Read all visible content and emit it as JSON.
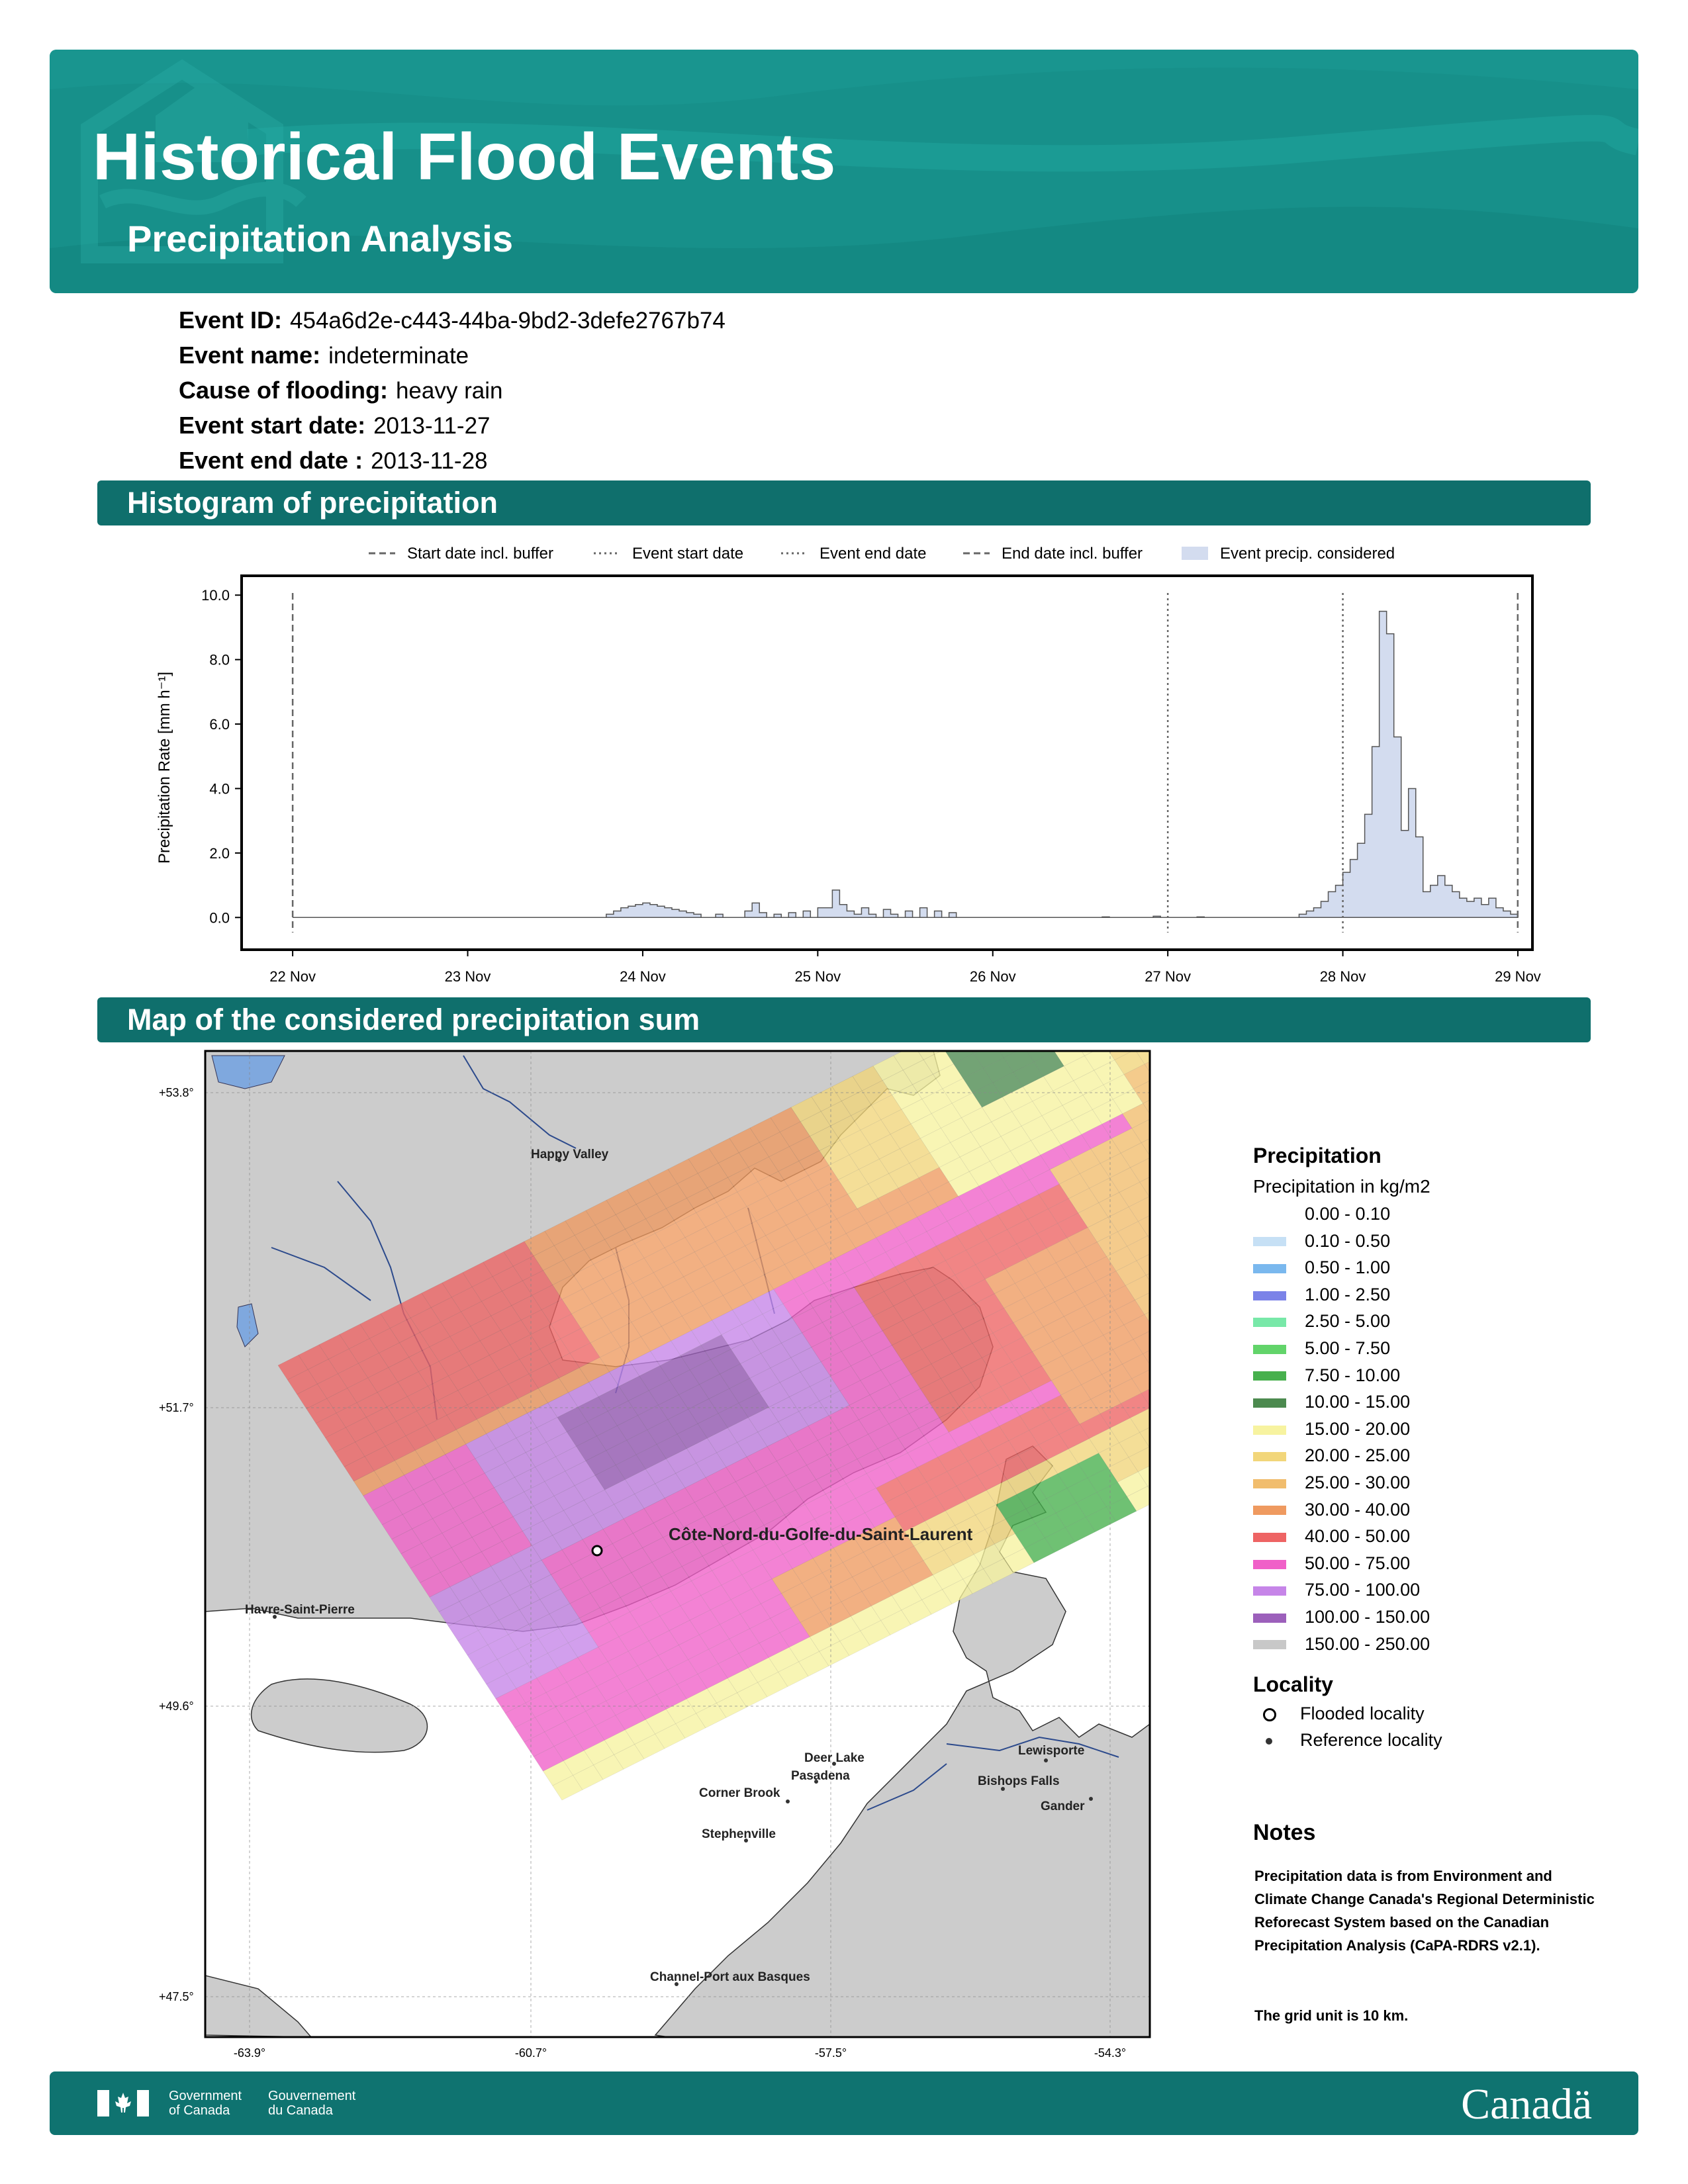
{
  "header": {
    "title": "Historical Flood Events",
    "subtitle": "Precipitation Analysis"
  },
  "event": {
    "id_label": "Event ID:",
    "id": "454a6d2e-c443-44ba-9bd2-3defe2767b74",
    "name_label": "Event name:",
    "name": "indeterminate",
    "cause_label": "Cause of flooding:",
    "cause": "heavy rain",
    "start_label": "Event start date:",
    "start": "2013-11-27",
    "end_label": "Event end date :",
    "end": "2013-11-28"
  },
  "histogram": {
    "section_title": "Histogram of precipitation",
    "legend": {
      "start_buffer": "Start date incl. buffer",
      "event_start": "Event start date",
      "event_end": "Event end date",
      "end_buffer": "End date incl. buffer",
      "considered": "Event precip. considered"
    },
    "colors": {
      "fill": "#d3dcef",
      "line": "#555555"
    }
  },
  "chart_data": {
    "type": "area",
    "title": "",
    "xlabel": "",
    "ylabel": "Precipitation Rate [mm h⁻¹]",
    "ylim": [
      -1.0,
      10.6
    ],
    "xlim": [
      "2013-11-21 17:00",
      "2013-11-29 02:00"
    ],
    "x_ticks": [
      "22 Nov",
      "23 Nov",
      "24 Nov",
      "25 Nov",
      "26 Nov",
      "27 Nov",
      "28 Nov",
      "29 Nov"
    ],
    "y_ticks": [
      "0.0",
      "2.0",
      "4.0",
      "6.0",
      "8.0",
      "10.0"
    ],
    "step_hours": 3,
    "start_time": "2013-11-22 00:00",
    "values": [
      0.0,
      0.0,
      0.0,
      0.0,
      0.0,
      0.0,
      0.0,
      0.0,
      0.0,
      0.0,
      0.0,
      0.0,
      0.0,
      0.0,
      0.0,
      0.0,
      0.1,
      0.3,
      0.4,
      0.4,
      0.3,
      0.2,
      0.1,
      0.1,
      0.1,
      0.2,
      0.1,
      0.2,
      0.1,
      0.4,
      0.1,
      0.0,
      0.0,
      0.0,
      0.0,
      0.0,
      0.0,
      0.0,
      0.0,
      0.0,
      0.0,
      0.0,
      0.0,
      0.0,
      0.0,
      0.0,
      0.0,
      0.0,
      0.0,
      0.0,
      0.0,
      0.0,
      0.1,
      0.0,
      0.0,
      0.0,
      0.3,
      0.6,
      1.2,
      2.1,
      9.5,
      5.8,
      1.5,
      0.8
    ],
    "fine_values": [
      0.0,
      0.0,
      0.0,
      0.0,
      0.0,
      0.0,
      0.0,
      0.0,
      0.0,
      0.0,
      0.0,
      0.0,
      0.0,
      0.0,
      0.0,
      0.0,
      0.0,
      0.0,
      0.0,
      0.0,
      0.0,
      0.0,
      0.0,
      0.0,
      0.0,
      0.0,
      0.0,
      0.0,
      0.0,
      0.0,
      0.0,
      0.0,
      0.0,
      0.0,
      0.0,
      0.0,
      0.0,
      0.0,
      0.0,
      0.0,
      0.0,
      0.0,
      0.0,
      0.0,
      0.0,
      0.0,
      0.0,
      0.0,
      0.0,
      0.0,
      0.0,
      0.1,
      0.15,
      0.2,
      0.3,
      0.35,
      0.4,
      0.4,
      0.45,
      0.45,
      0.45,
      0.4,
      0.4,
      0.35,
      0.3,
      0.25,
      0.2,
      0.2,
      0.15,
      0.1,
      0.1,
      0.1,
      0.1,
      0.1,
      0.1,
      0.1,
      0.1,
      0.15,
      0.2,
      0.2,
      0.2,
      0.5,
      0.2,
      0.1,
      0.1,
      0.1,
      0.1,
      0.1,
      0.1,
      0.2,
      0.2,
      0.2,
      0.3,
      0.2,
      0.2,
      0.3,
      0.3,
      0.3,
      0.3,
      0.3,
      0.3,
      0.4,
      0.3,
      0.9,
      0.5,
      0.2,
      0.1,
      0.3,
      0.1,
      0.1,
      0.1,
      0.3,
      0.2,
      0.1,
      0.2,
      0.2,
      0.2,
      0.3,
      0.2,
      0.1,
      0.2,
      0.2,
      0.2,
      0.2,
      0.2,
      0.2,
      0.1,
      0.0,
      0.0,
      0.0,
      0.0,
      0.0,
      0.0,
      0.0,
      0.0,
      0.0,
      0.0,
      0.0,
      0.0,
      0.0,
      0.0,
      0.0,
      0.0,
      0.0,
      0.0,
      0.0,
      0.0,
      0.0,
      0.0,
      0.0,
      0.0,
      0.0,
      0.0,
      0.0,
      0.0,
      0.0,
      0.0,
      0.0,
      0.0,
      0.0,
      0.0,
      0.0,
      0.0,
      0.0,
      0.0,
      0.0,
      0.0,
      0.0,
      0.0,
      0.0,
      0.0,
      0.0,
      0.0,
      0.0,
      0.0,
      0.0,
      0.0,
      0.0,
      0.0,
      0.0,
      0.0,
      0.0,
      0.0,
      0.0,
      0.0,
      0.0,
      0.0,
      0.0,
      0.0,
      0.0,
      0.0,
      0.0,
      0.0,
      0.0,
      0.0,
      0.0,
      0.0,
      0.0,
      0.0,
      0.0,
      0.0,
      0.0,
      0.0,
      0.0,
      0.0,
      0.0,
      0.0,
      0.0,
      0.0,
      0.0,
      0.0,
      0.0,
      0.0,
      0.0,
      0.0,
      0.0,
      0.0,
      0.0,
      0.0,
      0.0,
      0.0,
      0.0,
      0.0,
      0.0,
      0.0,
      0.0,
      0.0,
      0.0,
      0.0,
      0.0,
      0.0,
      0.0,
      0.0,
      0.0,
      0.0,
      0.0,
      0.0,
      0.0,
      0.0,
      0.0,
      0.0,
      0.0,
      0.0,
      0.0,
      0.0,
      0.0,
      0.0,
      0.0,
      0.0,
      0.0,
      0.0,
      0.0,
      0.0,
      0.0,
      0.0,
      0.0,
      0.0,
      0.0,
      0.0,
      0.0,
      0.0,
      0.0,
      0.0,
      0.0,
      0.0,
      0.0,
      0.0,
      0.0,
      0.0,
      0.0,
      0.0,
      0.0,
      0.0,
      0.0,
      0.0,
      0.0,
      0.0,
      0.0,
      0.0,
      0.0,
      0.0,
      0.0,
      0.0,
      0.0,
      0.0,
      0.0,
      0.0,
      0.0,
      0.0,
      0.0,
      0.0,
      0.0,
      0.0,
      0.0,
      0.0,
      0.0,
      0.0,
      0.0,
      0.0,
      0.0,
      0.0,
      0.0,
      0.0,
      0.0,
      0.0,
      0.0,
      0.0,
      0.0,
      0.0,
      0.0,
      0.0,
      0.0,
      0.0,
      0.0,
      0.0,
      0.0,
      0.0,
      0.0,
      0.0,
      0.0,
      0.0,
      0.0,
      0.0,
      0.0,
      0.0,
      0.0,
      0.0,
      0.0,
      0.0,
      0.0,
      0.0,
      0.0,
      0.0,
      0.0,
      0.0,
      0.0,
      0.0,
      0.0,
      0.0,
      0.0,
      0.0,
      0.0,
      0.0,
      0.0,
      0.0,
      0.0,
      0.0,
      0.0,
      0.0,
      0.0,
      0.0,
      0.0,
      0.0,
      0.0,
      0.0,
      0.0,
      0.0,
      0.0,
      0.0,
      0.0,
      0.0,
      0.0,
      0.0,
      0.0,
      0.0,
      0.0,
      0.0,
      0.0,
      0.0,
      0.0,
      0.0,
      0.0,
      0.0,
      0.0,
      0.0,
      0.0,
      0.0,
      0.0,
      0.0,
      0.0,
      0.0,
      0.0,
      0.0,
      0.0
    ],
    "vlines": [
      {
        "x": "2013-11-22 00:00",
        "style": "dashed",
        "name": "Start date incl. buffer"
      },
      {
        "x": "2013-11-27 00:00",
        "style": "dotted",
        "name": "Event start date"
      },
      {
        "x": "2013-11-28 00:00",
        "style": "dotted",
        "name": "Event end date"
      },
      {
        "x": "2013-11-28 23:59",
        "style": "dashed",
        "name": "End date incl. buffer"
      }
    ],
    "hourly_series": [
      {
        "t": "2013-11-23 19:00",
        "v": 0.1
      },
      {
        "t": "2013-11-23 20:00",
        "v": 0.2
      },
      {
        "t": "2013-11-23 21:00",
        "v": 0.3
      },
      {
        "t": "2013-11-23 22:00",
        "v": 0.35
      },
      {
        "t": "2013-11-23 23:00",
        "v": 0.4
      },
      {
        "t": "2013-11-24 00:00",
        "v": 0.45
      },
      {
        "t": "2013-11-24 01:00",
        "v": 0.4
      },
      {
        "t": "2013-11-24 02:00",
        "v": 0.35
      },
      {
        "t": "2013-11-24 03:00",
        "v": 0.3
      },
      {
        "t": "2013-11-24 04:00",
        "v": 0.25
      },
      {
        "t": "2013-11-24 05:00",
        "v": 0.2
      },
      {
        "t": "2013-11-24 06:00",
        "v": 0.15
      },
      {
        "t": "2013-11-24 07:00",
        "v": 0.1
      },
      {
        "t": "2013-11-24 10:00",
        "v": 0.1
      },
      {
        "t": "2013-11-24 14:00",
        "v": 0.2
      },
      {
        "t": "2013-11-24 15:00",
        "v": 0.45
      },
      {
        "t": "2013-11-24 16:00",
        "v": 0.15
      },
      {
        "t": "2013-11-24 18:00",
        "v": 0.1
      },
      {
        "t": "2013-11-24 20:00",
        "v": 0.15
      },
      {
        "t": "2013-11-24 22:00",
        "v": 0.2
      },
      {
        "t": "2013-11-25 00:00",
        "v": 0.3
      },
      {
        "t": "2013-11-25 01:00",
        "v": 0.3
      },
      {
        "t": "2013-11-25 02:00",
        "v": 0.85
      },
      {
        "t": "2013-11-25 03:00",
        "v": 0.4
      },
      {
        "t": "2013-11-25 04:00",
        "v": 0.2
      },
      {
        "t": "2013-11-25 05:00",
        "v": 0.1
      },
      {
        "t": "2013-11-25 06:00",
        "v": 0.3
      },
      {
        "t": "2013-11-25 07:00",
        "v": 0.1
      },
      {
        "t": "2013-11-25 09:00",
        "v": 0.25
      },
      {
        "t": "2013-11-25 10:00",
        "v": 0.1
      },
      {
        "t": "2013-11-25 12:00",
        "v": 0.2
      },
      {
        "t": "2013-11-25 14:00",
        "v": 0.3
      },
      {
        "t": "2013-11-25 16:00",
        "v": 0.2
      },
      {
        "t": "2013-11-25 18:00",
        "v": 0.15
      },
      {
        "t": "2013-11-25 20:00",
        "v": 0.0
      },
      {
        "t": "2013-11-26 15:00",
        "v": 0.02
      },
      {
        "t": "2013-11-26 22:00",
        "v": 0.04
      },
      {
        "t": "2013-11-27 04:00",
        "v": 0.02
      },
      {
        "t": "2013-11-27 18:00",
        "v": 0.1
      },
      {
        "t": "2013-11-27 19:00",
        "v": 0.2
      },
      {
        "t": "2013-11-27 20:00",
        "v": 0.3
      },
      {
        "t": "2013-11-27 21:00",
        "v": 0.5
      },
      {
        "t": "2013-11-27 22:00",
        "v": 0.8
      },
      {
        "t": "2013-11-27 23:00",
        "v": 1.0
      },
      {
        "t": "2013-11-28 00:00",
        "v": 1.4
      },
      {
        "t": "2013-11-28 01:00",
        "v": 1.8
      },
      {
        "t": "2013-11-28 02:00",
        "v": 2.3
      },
      {
        "t": "2013-11-28 03:00",
        "v": 3.2
      },
      {
        "t": "2013-11-28 04:00",
        "v": 5.3
      },
      {
        "t": "2013-11-28 05:00",
        "v": 9.5
      },
      {
        "t": "2013-11-28 06:00",
        "v": 8.8
      },
      {
        "t": "2013-11-28 07:00",
        "v": 5.6
      },
      {
        "t": "2013-11-28 08:00",
        "v": 2.7
      },
      {
        "t": "2013-11-28 09:00",
        "v": 4.0
      },
      {
        "t": "2013-11-28 10:00",
        "v": 2.5
      },
      {
        "t": "2013-11-28 11:00",
        "v": 0.8
      },
      {
        "t": "2013-11-28 12:00",
        "v": 1.0
      },
      {
        "t": "2013-11-28 13:00",
        "v": 1.3
      },
      {
        "t": "2013-11-28 14:00",
        "v": 1.0
      },
      {
        "t": "2013-11-28 15:00",
        "v": 0.8
      },
      {
        "t": "2013-11-28 16:00",
        "v": 0.6
      },
      {
        "t": "2013-11-28 17:00",
        "v": 0.5
      },
      {
        "t": "2013-11-28 18:00",
        "v": 0.6
      },
      {
        "t": "2013-11-28 19:00",
        "v": 0.4
      },
      {
        "t": "2013-11-28 20:00",
        "v": 0.6
      },
      {
        "t": "2013-11-28 21:00",
        "v": 0.3
      },
      {
        "t": "2013-11-28 22:00",
        "v": 0.2
      },
      {
        "t": "2013-11-28 23:00",
        "v": 0.1
      }
    ]
  },
  "map": {
    "section_title": "Map of the considered precipitation sum",
    "lat_labels": [
      "+53.8°",
      "+51.7°",
      "+49.6°",
      "+47.5°"
    ],
    "lon_labels": [
      "-63.9°",
      "-60.7°",
      "-57.5°",
      "-54.3°"
    ],
    "places": {
      "flooded": "Côte-Nord-du-Golfe-du-Saint-Laurent",
      "happy_valley": "Happy Valley",
      "havre": "Havre-Saint-Pierre",
      "deer_lake": "Deer Lake",
      "pasadena": "Pasadena",
      "corner_brook": "Corner Brook",
      "stephenville": "Stephenville",
      "channel": "Channel-Port aux Basques",
      "lewisporte": "Lewisporte",
      "bishops": "Bishops Falls",
      "gander": "Gander"
    },
    "colors": {
      "land": "#cccccc",
      "water": "#ffffff",
      "lakes": "#7fa8de"
    }
  },
  "legend": {
    "title": "Precipitation",
    "subtitle": "Precipitation in kg/m2",
    "items": [
      {
        "label": "0.00 - 0.10",
        "color": "#ffffff"
      },
      {
        "label": "0.10 - 0.50",
        "color": "#c6e0f5"
      },
      {
        "label": "0.50 - 1.00",
        "color": "#7ab8ee"
      },
      {
        "label": "1.00 - 2.50",
        "color": "#7b83e8"
      },
      {
        "label": "2.50 - 5.00",
        "color": "#78e8a8"
      },
      {
        "label": "5.00 - 7.50",
        "color": "#62d46a"
      },
      {
        "label": "7.50 - 10.00",
        "color": "#47b04d"
      },
      {
        "label": "10.00 - 15.00",
        "color": "#4c8a4f"
      },
      {
        "label": "15.00 - 20.00",
        "color": "#f7f3a0"
      },
      {
        "label": "20.00 - 25.00",
        "color": "#f2d67a"
      },
      {
        "label": "25.00 - 30.00",
        "color": "#f1bd6d"
      },
      {
        "label": "30.00 - 40.00",
        "color": "#ef9a60"
      },
      {
        "label": "40.00 - 50.00",
        "color": "#ee6464"
      },
      {
        "label": "50.00 - 75.00",
        "color": "#f060c8"
      },
      {
        "label": "75.00 - 100.00",
        "color": "#c685e8"
      },
      {
        "label": "100.00 - 150.00",
        "color": "#9c60bb"
      },
      {
        "label": "150.00 - 250.00",
        "color": "#c8c8c8"
      }
    ],
    "locality_title": "Locality",
    "flooded_label": "Flooded locality",
    "reference_label": "Reference locality"
  },
  "notes": {
    "title": "Notes",
    "text1": "Precipitation data is from Environment and Climate Change Canada's Regional Deterministic Reforecast System based on the Canadian Precipitation Analysis (CaPA-RDRS v2.1).",
    "text2": "The grid unit is 10 km."
  },
  "footer": {
    "gov_en_1": "Government",
    "gov_en_2": "of Canada",
    "gov_fr_1": "Gouvernement",
    "gov_fr_2": "du Canada",
    "wordmark": "Canadä"
  }
}
